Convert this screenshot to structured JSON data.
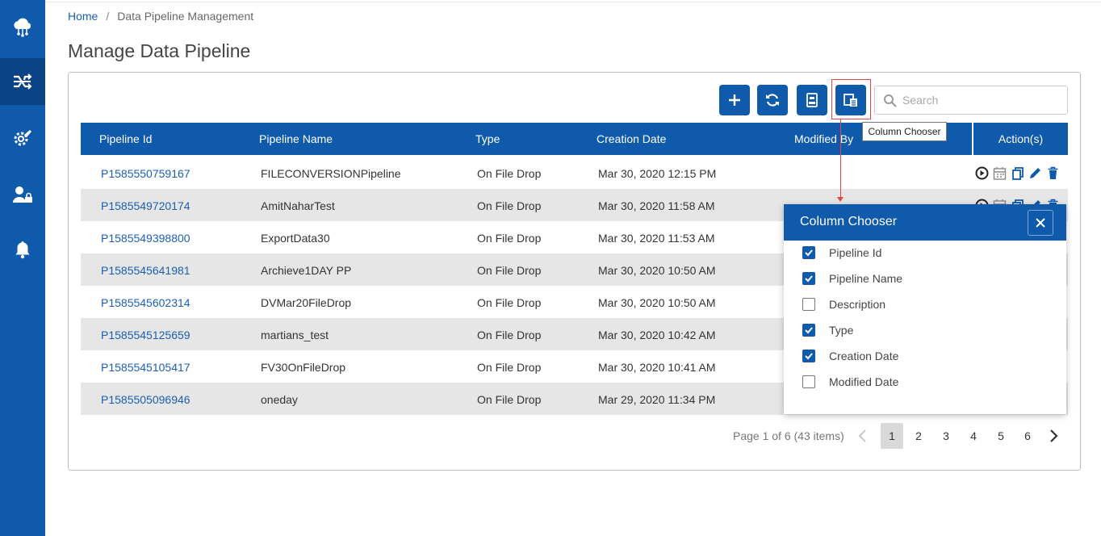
{
  "sidebar": {
    "items": [
      {
        "icon": "cloud-network-icon"
      },
      {
        "icon": "pipeline-shuffle-icon"
      },
      {
        "icon": "settings-gear-icon"
      },
      {
        "icon": "user-lock-icon"
      },
      {
        "icon": "bell-icon"
      }
    ]
  },
  "breadcrumb": {
    "home": "Home",
    "separator": "/",
    "current": "Data Pipeline Management"
  },
  "page_title": "Manage Data Pipeline",
  "toolbar": {
    "add_icon": "plus-icon",
    "refresh_icon": "refresh-icon",
    "export_icon": "xlsx-export-icon",
    "column_chooser_icon": "column-chooser-icon",
    "tooltip": "Column Chooser"
  },
  "search": {
    "placeholder": "Search",
    "value": ""
  },
  "table": {
    "columns": [
      "Pipeline Id",
      "Pipeline Name",
      "Type",
      "Creation Date",
      "Modified By"
    ],
    "actions_header": "Action(s)",
    "rows": [
      {
        "id": "P1585550759167",
        "name": "FILECONVERSIONPipeline",
        "type": "On File Drop",
        "created": "Mar 30, 2020 12:15 PM"
      },
      {
        "id": "P1585549720174",
        "name": "AmitNaharTest",
        "type": "On File Drop",
        "created": "Mar 30, 2020 11:58 AM"
      },
      {
        "id": "P1585549398800",
        "name": "ExportData30",
        "type": "On File Drop",
        "created": "Mar 30, 2020 11:53 AM"
      },
      {
        "id": "P1585545641981",
        "name": "Archieve1DAY PP",
        "type": "On File Drop",
        "created": "Mar 30, 2020 10:50 AM"
      },
      {
        "id": "P1585545602314",
        "name": "DVMar20FileDrop",
        "type": "On File Drop",
        "created": "Mar 30, 2020 10:50 AM"
      },
      {
        "id": "P1585545125659",
        "name": "martians_test",
        "type": "On File Drop",
        "created": "Mar 30, 2020 10:42 AM"
      },
      {
        "id": "P1585545105417",
        "name": "FV30OnFileDrop",
        "type": "On File Drop",
        "created": "Mar 30, 2020 10:41 AM"
      },
      {
        "id": "P1585505096946",
        "name": "oneday",
        "type": "On File Drop",
        "created": "Mar 29, 2020 11:34 PM"
      }
    ]
  },
  "column_chooser": {
    "title": "Column Chooser",
    "options": [
      {
        "label": "Pipeline Id",
        "checked": true
      },
      {
        "label": "Pipeline Name",
        "checked": true
      },
      {
        "label": "Description",
        "checked": false
      },
      {
        "label": "Type",
        "checked": true
      },
      {
        "label": "Creation Date",
        "checked": true
      },
      {
        "label": "Modified Date",
        "checked": false
      }
    ]
  },
  "pager": {
    "info": "Page 1 of 6 (43 items)",
    "pages": [
      "1",
      "2",
      "3",
      "4",
      "5",
      "6"
    ],
    "current": "1"
  },
  "colors": {
    "primary": "#0f5aab",
    "sidebar_active": "#0a4486",
    "link": "#1a5fb4",
    "highlight_border": "#e04848",
    "row_alt": "#e6e6e6"
  }
}
